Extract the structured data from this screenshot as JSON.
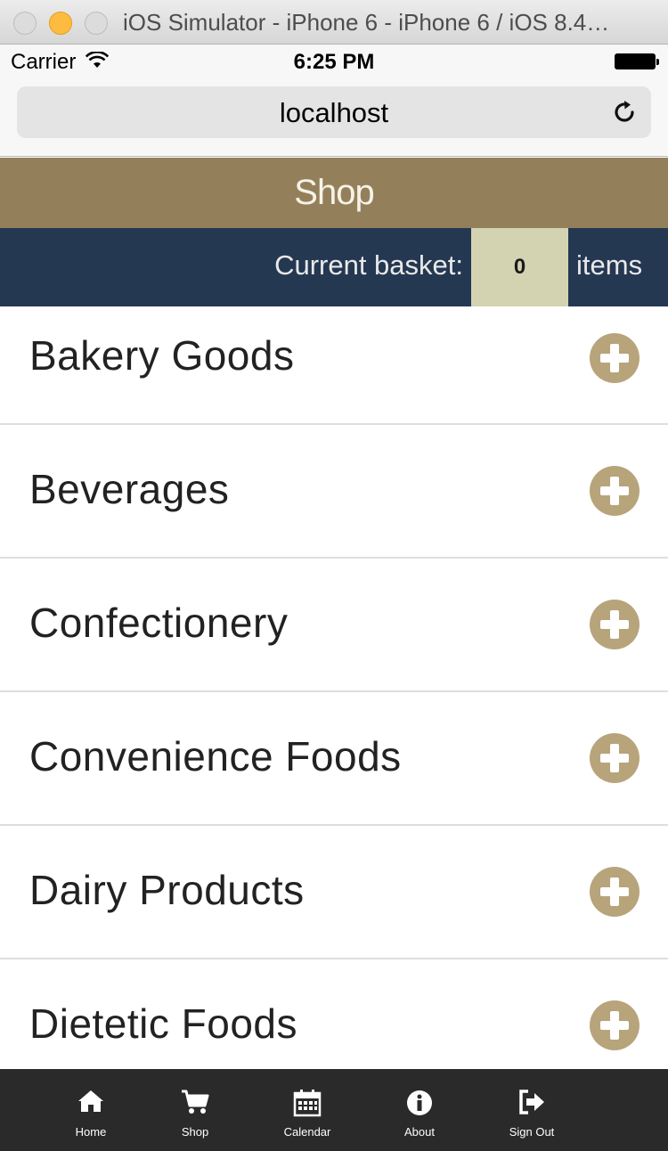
{
  "window": {
    "title": "iOS Simulator - iPhone 6 - iPhone 6 / iOS 8.4…"
  },
  "status_bar": {
    "carrier": "Carrier",
    "time": "6:25 PM"
  },
  "browser": {
    "address": "localhost"
  },
  "header": {
    "title": "Shop"
  },
  "basket": {
    "label": "Current basket:",
    "count": "0",
    "unit": "items"
  },
  "categories": [
    {
      "label": "Bakery Goods"
    },
    {
      "label": "Beverages"
    },
    {
      "label": "Confectionery"
    },
    {
      "label": "Convenience Foods"
    },
    {
      "label": "Dairy Products"
    },
    {
      "label": "Dietetic Foods"
    }
  ],
  "tabs": [
    {
      "label": "Home",
      "icon": "home-icon"
    },
    {
      "label": "Shop",
      "icon": "cart-icon"
    },
    {
      "label": "Calendar",
      "icon": "calendar-icon"
    },
    {
      "label": "About",
      "icon": "info-icon"
    },
    {
      "label": "Sign Out",
      "icon": "sign-out-icon"
    }
  ],
  "colors": {
    "header": "#93805a",
    "basket_bar": "#253852",
    "basket_count": "#d3d3b2",
    "add_button": "#b7a47b",
    "tabbar": "#2a2a2a"
  }
}
